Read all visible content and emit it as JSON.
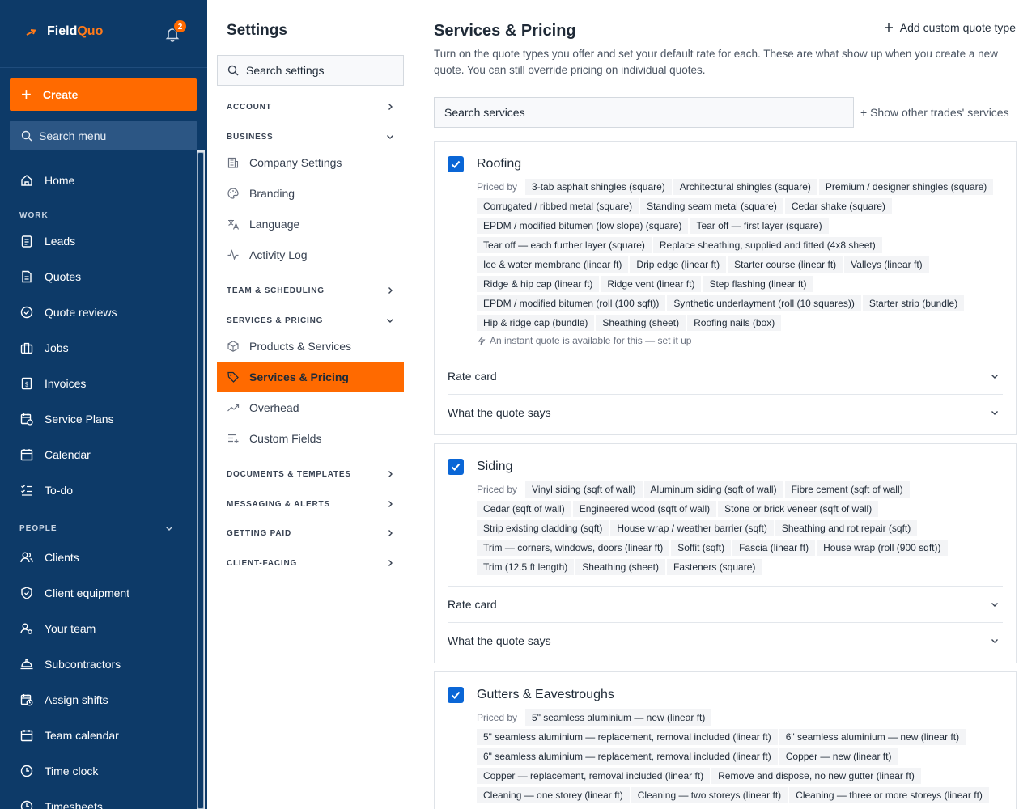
{
  "nav": {
    "brand_a": "Field",
    "brand_b": "Quo",
    "notification_count": "2",
    "create_label": "Create",
    "search_label": "Search menu",
    "home": "Home",
    "work_section": "WORK",
    "work_items": [
      "Leads",
      "Quotes",
      "Quote reviews",
      "Jobs",
      "Invoices",
      "Service Plans",
      "Calendar",
      "To-do"
    ],
    "people_section": "PEOPLE",
    "people_items": [
      "Clients",
      "Client equipment",
      "Your team",
      "Subcontractors",
      "Assign shifts",
      "Team calendar",
      "Time clock",
      "Timesheets"
    ]
  },
  "settings": {
    "title": "Settings",
    "search_placeholder": "Search settings",
    "groups": {
      "account": "ACCOUNT",
      "business": "BUSINESS",
      "team": "TEAM & SCHEDULING",
      "services": "SERVICES & PRICING",
      "documents": "DOCUMENTS & TEMPLATES",
      "messaging": "MESSAGING & ALERTS",
      "getting_paid": "GETTING PAID",
      "client_facing": "CLIENT-FACING"
    },
    "business_items": [
      "Company Settings",
      "Branding",
      "Language",
      "Activity Log"
    ],
    "services_items": [
      "Products & Services",
      "Services & Pricing",
      "Overhead",
      "Custom Fields"
    ]
  },
  "main": {
    "title": "Services & Pricing",
    "add_custom": "Add custom quote type",
    "intro": "Turn on the quote types you offer and set your default rate for each. These are what show up when you create a new quote. You can still override pricing on individual quotes.",
    "search_placeholder": "Search services",
    "show_other": "+ Show other trades' services",
    "priced_by": "Priced by",
    "rate_card": "Rate card",
    "quote_says": "What the quote says",
    "instant_quote": "An instant quote is available for this — set it up",
    "cards": [
      {
        "title": "Roofing",
        "checked": true,
        "chips": [
          "3-tab asphalt shingles (square)",
          "Architectural shingles (square)",
          "Premium / designer shingles (square)",
          "Corrugated / ribbed metal (square)",
          "Standing seam metal (square)",
          "Cedar shake (square)",
          "EPDM / modified bitumen (low slope) (square)",
          "Tear off — first layer (square)",
          "Tear off — each further layer (square)",
          "Replace sheathing, supplied and fitted (4x8 sheet)",
          "Ice & water membrane (linear ft)",
          "Drip edge (linear ft)",
          "Starter course (linear ft)",
          "Valleys (linear ft)",
          "Ridge & hip cap (linear ft)",
          "Ridge vent (linear ft)",
          "Step flashing (linear ft)",
          "EPDM / modified bitumen (roll (100 sqft))",
          "Synthetic underlayment (roll (10 squares))",
          "Starter strip (bundle)",
          "Hip & ridge cap (bundle)",
          "Sheathing (sheet)",
          "Roofing nails (box)"
        ]
      },
      {
        "title": "Siding",
        "checked": true,
        "chips": [
          "Vinyl siding (sqft of wall)",
          "Aluminum siding (sqft of wall)",
          "Fibre cement (sqft of wall)",
          "Cedar (sqft of wall)",
          "Engineered wood (sqft of wall)",
          "Stone or brick veneer (sqft of wall)",
          "Strip existing cladding (sqft)",
          "House wrap / weather barrier (sqft)",
          "Sheathing and rot repair (sqft)",
          "Trim — corners, windows, doors (linear ft)",
          "Soffit (sqft)",
          "Fascia (linear ft)",
          "House wrap (roll (900 sqft))",
          "Trim (12.5 ft length)",
          "Sheathing (sheet)",
          "Fasteners (square)"
        ]
      },
      {
        "title": "Gutters & Eavestroughs",
        "checked": true,
        "chips": [
          "5\" seamless aluminium — new (linear ft)",
          "5\" seamless aluminium — replacement, removal included (linear ft)",
          "6\" seamless aluminium — new (linear ft)",
          "6\" seamless aluminium — replacement, removal included (linear ft)",
          "Copper — new (linear ft)",
          "Copper — replacement, removal included (linear ft)",
          "Remove and dispose, no new gutter (linear ft)",
          "Cleaning — one storey (linear ft)",
          "Cleaning — two storeys (linear ft)",
          "Cleaning — three or more storeys (linear ft)"
        ]
      }
    ]
  },
  "colors": {
    "nav_bg": "#0d3a68",
    "accent": "#ff6a00",
    "checkbox": "#0a66d6"
  }
}
